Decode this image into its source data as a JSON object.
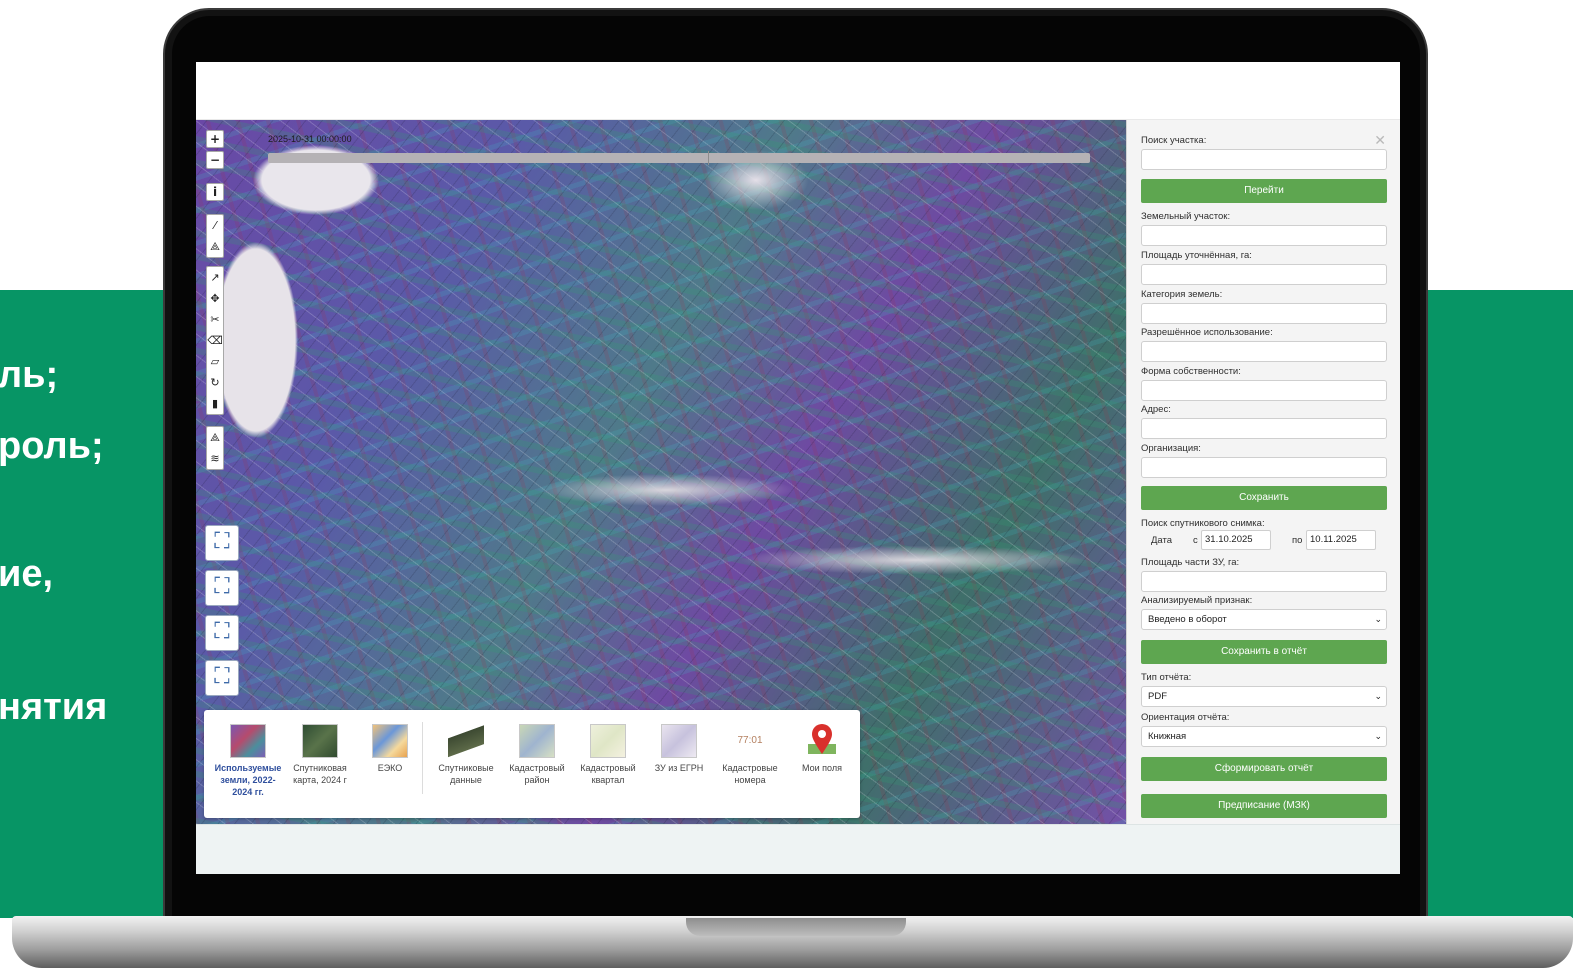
{
  "promo": {
    "lines": [
      "ль;",
      "роль;",
      "ие,",
      "нятия"
    ],
    "band_color": "#079565"
  },
  "map": {
    "timestamp": "2025-10-31 00:00:00",
    "zoom_in": "+",
    "zoom_out": "−",
    "info": "i",
    "icons": [
      "zoom-in-icon",
      "zoom-out-icon",
      "info-icon",
      "draw-line-icon",
      "draw-polygon-icon",
      "vertex-edit-icon",
      "move-icon",
      "cut-icon",
      "eraser-icon",
      "ruler-icon",
      "rotate-icon",
      "trash-icon",
      "measure-icon",
      "layers-stack-icon",
      "field-marker-icon"
    ]
  },
  "layers": {
    "items": [
      {
        "label": "Используемые земли, 2022-2024 гг.",
        "icon": "used-lands-thumbnail",
        "active": true
      },
      {
        "label": "Спутниковая карта, 2024 г",
        "icon": "satellite-map-thumbnail"
      },
      {
        "label": "ЕЭКО",
        "icon": "eeko-thumbnail"
      },
      {
        "label": "Спутниковые данные",
        "icon": "satellite-data-thumbnail"
      },
      {
        "label": "Кадастровый район",
        "icon": "cadastral-district-thumbnail"
      },
      {
        "label": "Кадастровый квартал",
        "icon": "cadastral-quarter-thumbnail"
      },
      {
        "label": "ЗУ из ЕГРН",
        "icon": "egrn-parcels-thumbnail"
      },
      {
        "label": "Кадастровые номера",
        "thumb_text": "77:01",
        "icon": "cadastral-numbers-thumbnail"
      },
      {
        "label": "Мои поля",
        "icon": "my-fields-pin-icon"
      }
    ]
  },
  "sidebar": {
    "search_label": "Поиск участка:",
    "search_value": "",
    "go_button": "Перейти",
    "parcel_label": "Земельный участок:",
    "area_label": "Площадь уточнённая, га:",
    "category_label": "Категория земель:",
    "allowed_use_label": "Разрешённое использование:",
    "ownership_label": "Форма собственности:",
    "address_label": "Адрес:",
    "org_label": "Организация:",
    "save_button": "Сохранить",
    "sat_search_label": "Поиск спутникового снимка:",
    "date_label": "Дата",
    "from_label": "с",
    "from_date": "31.10.2025",
    "to_label": "по",
    "to_date": "10.11.2025",
    "part_area_label": "Площадь части ЗУ, га:",
    "feature_label": "Анализируемый признак:",
    "feature_value": "Введено в оборот",
    "save_report_button": "Сохранить в отчёт",
    "report_type_label": "Тип отчёта:",
    "report_type_value": "PDF",
    "orientation_label": "Ориентация отчёта:",
    "orientation_value": "Книжная",
    "make_report_button": "Сформировать отчёт",
    "order_button": "Предписание (МЗК)",
    "accent_color": "#5ea650"
  }
}
